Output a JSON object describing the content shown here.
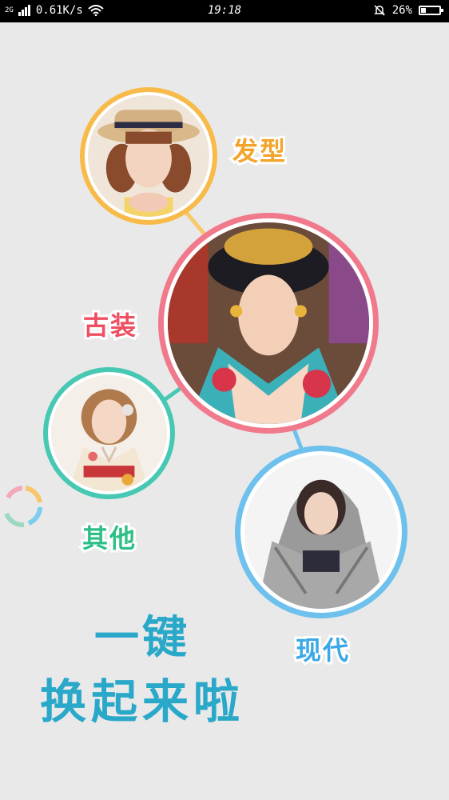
{
  "status_bar": {
    "signal": "2G",
    "speed": "0.61K/s",
    "time": "19:18",
    "battery": "26%",
    "battery_level": 0.26
  },
  "categories": [
    {
      "label": "发型",
      "color": "#f3a42a",
      "ring": "#f8bb4a"
    },
    {
      "label": "古装",
      "color": "#ee4f62",
      "ring": "#f07a8c"
    },
    {
      "label": "其他",
      "color": "#2cbf86",
      "ring": "#46c8b3"
    },
    {
      "label": "现代",
      "color": "#3aa8e6",
      "ring": "#6ec1ec"
    }
  ],
  "slogan": {
    "line1": "一键",
    "line2": "换起来啦",
    "color": "#2aa8c9"
  }
}
